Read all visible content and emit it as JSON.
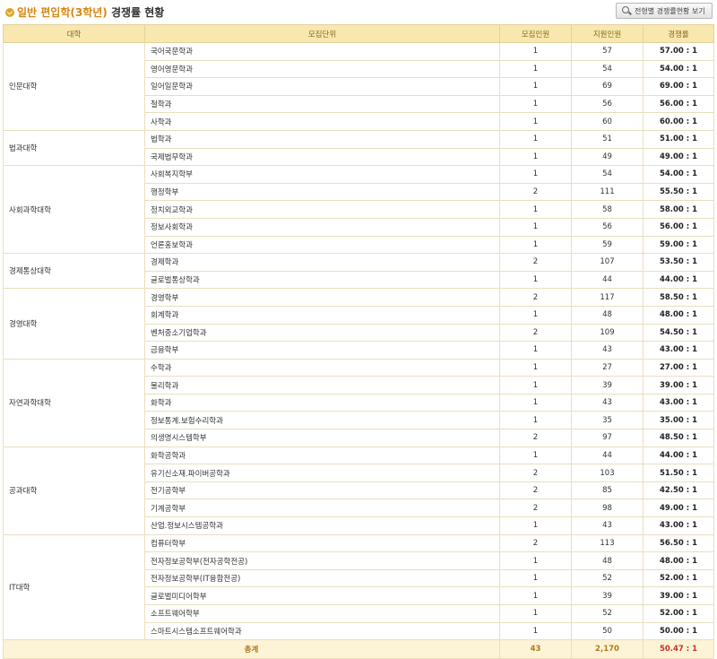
{
  "header": {
    "title_orange": "일반 편입학(3학년)",
    "title_rest": "경쟁률 현황",
    "button_label": "전형별 경쟁률현황 보기"
  },
  "table": {
    "columns": [
      "대학",
      "모집단위",
      "모집인원",
      "지원인원",
      "경쟁률"
    ],
    "groups": [
      {
        "college": "인문대학",
        "rows": [
          {
            "dept": "국어국문학과",
            "recruit": "1",
            "applied": "57",
            "ratio": "57.00 : 1"
          },
          {
            "dept": "영어영문학과",
            "recruit": "1",
            "applied": "54",
            "ratio": "54.00 : 1"
          },
          {
            "dept": "일어일문학과",
            "recruit": "1",
            "applied": "69",
            "ratio": "69.00 : 1"
          },
          {
            "dept": "철학과",
            "recruit": "1",
            "applied": "56",
            "ratio": "56.00 : 1"
          },
          {
            "dept": "사학과",
            "recruit": "1",
            "applied": "60",
            "ratio": "60.00 : 1"
          }
        ]
      },
      {
        "college": "법과대학",
        "rows": [
          {
            "dept": "법학과",
            "recruit": "1",
            "applied": "51",
            "ratio": "51.00 : 1"
          },
          {
            "dept": "국제법무학과",
            "recruit": "1",
            "applied": "49",
            "ratio": "49.00 : 1"
          }
        ]
      },
      {
        "college": "사회과학대학",
        "rows": [
          {
            "dept": "사회복지학부",
            "recruit": "1",
            "applied": "54",
            "ratio": "54.00 : 1"
          },
          {
            "dept": "행정학부",
            "recruit": "2",
            "applied": "111",
            "ratio": "55.50 : 1"
          },
          {
            "dept": "정치외교학과",
            "recruit": "1",
            "applied": "58",
            "ratio": "58.00 : 1"
          },
          {
            "dept": "정보사회학과",
            "recruit": "1",
            "applied": "56",
            "ratio": "56.00 : 1"
          },
          {
            "dept": "언론홍보학과",
            "recruit": "1",
            "applied": "59",
            "ratio": "59.00 : 1"
          }
        ]
      },
      {
        "college": "경제통상대학",
        "rows": [
          {
            "dept": "경제학과",
            "recruit": "2",
            "applied": "107",
            "ratio": "53.50 : 1"
          },
          {
            "dept": "글로벌통상학과",
            "recruit": "1",
            "applied": "44",
            "ratio": "44.00 : 1"
          }
        ]
      },
      {
        "college": "경영대학",
        "rows": [
          {
            "dept": "경영학부",
            "recruit": "2",
            "applied": "117",
            "ratio": "58.50 : 1"
          },
          {
            "dept": "회계학과",
            "recruit": "1",
            "applied": "48",
            "ratio": "48.00 : 1"
          },
          {
            "dept": "벤처중소기업학과",
            "recruit": "2",
            "applied": "109",
            "ratio": "54.50 : 1"
          },
          {
            "dept": "금융학부",
            "recruit": "1",
            "applied": "43",
            "ratio": "43.00 : 1"
          }
        ]
      },
      {
        "college": "자연과학대학",
        "rows": [
          {
            "dept": "수학과",
            "recruit": "1",
            "applied": "27",
            "ratio": "27.00 : 1"
          },
          {
            "dept": "물리학과",
            "recruit": "1",
            "applied": "39",
            "ratio": "39.00 : 1"
          },
          {
            "dept": "화학과",
            "recruit": "1",
            "applied": "43",
            "ratio": "43.00 : 1"
          },
          {
            "dept": "정보통계.보험수리학과",
            "recruit": "1",
            "applied": "35",
            "ratio": "35.00 : 1"
          },
          {
            "dept": "의생명시스템학부",
            "recruit": "2",
            "applied": "97",
            "ratio": "48.50 : 1"
          }
        ]
      },
      {
        "college": "공과대학",
        "rows": [
          {
            "dept": "화학공학과",
            "recruit": "1",
            "applied": "44",
            "ratio": "44.00 : 1"
          },
          {
            "dept": "유기신소재.파이버공학과",
            "recruit": "2",
            "applied": "103",
            "ratio": "51.50 : 1"
          },
          {
            "dept": "전기공학부",
            "recruit": "2",
            "applied": "85",
            "ratio": "42.50 : 1"
          },
          {
            "dept": "기계공학부",
            "recruit": "2",
            "applied": "98",
            "ratio": "49.00 : 1"
          },
          {
            "dept": "산업.정보시스템공학과",
            "recruit": "1",
            "applied": "43",
            "ratio": "43.00 : 1"
          }
        ]
      },
      {
        "college": "IT대학",
        "rows": [
          {
            "dept": "컴퓨터학부",
            "recruit": "2",
            "applied": "113",
            "ratio": "56.50 : 1"
          },
          {
            "dept": "전자정보공학부(전자공학전공)",
            "recruit": "1",
            "applied": "48",
            "ratio": "48.00 : 1"
          },
          {
            "dept": "전자정보공학부(IT융합전공)",
            "recruit": "1",
            "applied": "52",
            "ratio": "52.00 : 1"
          },
          {
            "dept": "글로벌미디어학부",
            "recruit": "1",
            "applied": "39",
            "ratio": "39.00 : 1"
          },
          {
            "dept": "소프트웨어학부",
            "recruit": "1",
            "applied": "52",
            "ratio": "52.00 : 1"
          },
          {
            "dept": "스마트시스템소프트웨어학과",
            "recruit": "1",
            "applied": "50",
            "ratio": "50.00 : 1"
          }
        ]
      }
    ],
    "total": {
      "label": "총계",
      "recruit": "43",
      "applied": "2,170",
      "ratio": "50.47 : 1"
    }
  },
  "colors": {
    "accent": "#d98612",
    "header_bg": "#f8e7ae",
    "total_ratio": "#c4322a"
  }
}
